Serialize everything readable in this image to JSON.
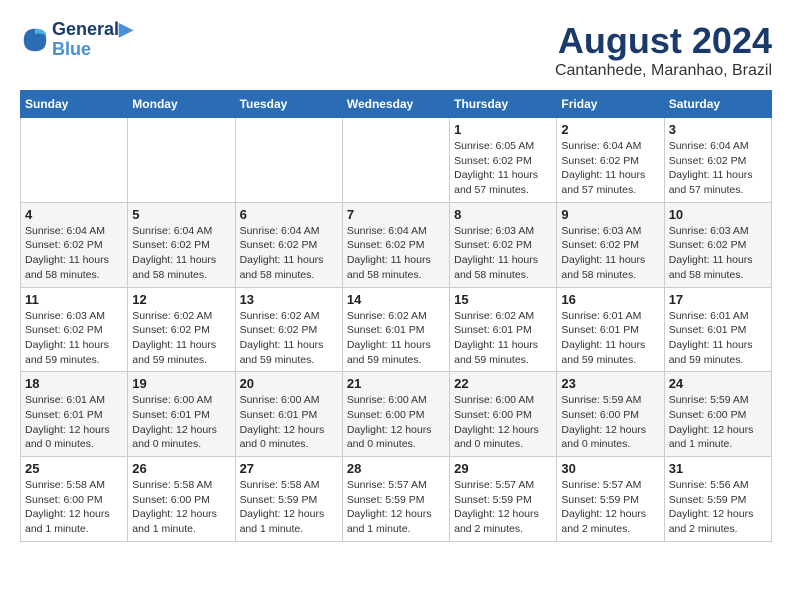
{
  "header": {
    "logo_line1": "General",
    "logo_line2": "Blue",
    "month_year": "August 2024",
    "location": "Cantanhede, Maranhao, Brazil"
  },
  "weekdays": [
    "Sunday",
    "Monday",
    "Tuesday",
    "Wednesday",
    "Thursday",
    "Friday",
    "Saturday"
  ],
  "weeks": [
    [
      {
        "day": "",
        "info": ""
      },
      {
        "day": "",
        "info": ""
      },
      {
        "day": "",
        "info": ""
      },
      {
        "day": "",
        "info": ""
      },
      {
        "day": "1",
        "info": "Sunrise: 6:05 AM\nSunset: 6:02 PM\nDaylight: 11 hours and 57 minutes."
      },
      {
        "day": "2",
        "info": "Sunrise: 6:04 AM\nSunset: 6:02 PM\nDaylight: 11 hours and 57 minutes."
      },
      {
        "day": "3",
        "info": "Sunrise: 6:04 AM\nSunset: 6:02 PM\nDaylight: 11 hours and 57 minutes."
      }
    ],
    [
      {
        "day": "4",
        "info": "Sunrise: 6:04 AM\nSunset: 6:02 PM\nDaylight: 11 hours and 58 minutes."
      },
      {
        "day": "5",
        "info": "Sunrise: 6:04 AM\nSunset: 6:02 PM\nDaylight: 11 hours and 58 minutes."
      },
      {
        "day": "6",
        "info": "Sunrise: 6:04 AM\nSunset: 6:02 PM\nDaylight: 11 hours and 58 minutes."
      },
      {
        "day": "7",
        "info": "Sunrise: 6:04 AM\nSunset: 6:02 PM\nDaylight: 11 hours and 58 minutes."
      },
      {
        "day": "8",
        "info": "Sunrise: 6:03 AM\nSunset: 6:02 PM\nDaylight: 11 hours and 58 minutes."
      },
      {
        "day": "9",
        "info": "Sunrise: 6:03 AM\nSunset: 6:02 PM\nDaylight: 11 hours and 58 minutes."
      },
      {
        "day": "10",
        "info": "Sunrise: 6:03 AM\nSunset: 6:02 PM\nDaylight: 11 hours and 58 minutes."
      }
    ],
    [
      {
        "day": "11",
        "info": "Sunrise: 6:03 AM\nSunset: 6:02 PM\nDaylight: 11 hours and 59 minutes."
      },
      {
        "day": "12",
        "info": "Sunrise: 6:02 AM\nSunset: 6:02 PM\nDaylight: 11 hours and 59 minutes."
      },
      {
        "day": "13",
        "info": "Sunrise: 6:02 AM\nSunset: 6:02 PM\nDaylight: 11 hours and 59 minutes."
      },
      {
        "day": "14",
        "info": "Sunrise: 6:02 AM\nSunset: 6:01 PM\nDaylight: 11 hours and 59 minutes."
      },
      {
        "day": "15",
        "info": "Sunrise: 6:02 AM\nSunset: 6:01 PM\nDaylight: 11 hours and 59 minutes."
      },
      {
        "day": "16",
        "info": "Sunrise: 6:01 AM\nSunset: 6:01 PM\nDaylight: 11 hours and 59 minutes."
      },
      {
        "day": "17",
        "info": "Sunrise: 6:01 AM\nSunset: 6:01 PM\nDaylight: 11 hours and 59 minutes."
      }
    ],
    [
      {
        "day": "18",
        "info": "Sunrise: 6:01 AM\nSunset: 6:01 PM\nDaylight: 12 hours and 0 minutes."
      },
      {
        "day": "19",
        "info": "Sunrise: 6:00 AM\nSunset: 6:01 PM\nDaylight: 12 hours and 0 minutes."
      },
      {
        "day": "20",
        "info": "Sunrise: 6:00 AM\nSunset: 6:01 PM\nDaylight: 12 hours and 0 minutes."
      },
      {
        "day": "21",
        "info": "Sunrise: 6:00 AM\nSunset: 6:00 PM\nDaylight: 12 hours and 0 minutes."
      },
      {
        "day": "22",
        "info": "Sunrise: 6:00 AM\nSunset: 6:00 PM\nDaylight: 12 hours and 0 minutes."
      },
      {
        "day": "23",
        "info": "Sunrise: 5:59 AM\nSunset: 6:00 PM\nDaylight: 12 hours and 0 minutes."
      },
      {
        "day": "24",
        "info": "Sunrise: 5:59 AM\nSunset: 6:00 PM\nDaylight: 12 hours and 1 minute."
      }
    ],
    [
      {
        "day": "25",
        "info": "Sunrise: 5:58 AM\nSunset: 6:00 PM\nDaylight: 12 hours and 1 minute."
      },
      {
        "day": "26",
        "info": "Sunrise: 5:58 AM\nSunset: 6:00 PM\nDaylight: 12 hours and 1 minute."
      },
      {
        "day": "27",
        "info": "Sunrise: 5:58 AM\nSunset: 5:59 PM\nDaylight: 12 hours and 1 minute."
      },
      {
        "day": "28",
        "info": "Sunrise: 5:57 AM\nSunset: 5:59 PM\nDaylight: 12 hours and 1 minute."
      },
      {
        "day": "29",
        "info": "Sunrise: 5:57 AM\nSunset: 5:59 PM\nDaylight: 12 hours and 2 minutes."
      },
      {
        "day": "30",
        "info": "Sunrise: 5:57 AM\nSunset: 5:59 PM\nDaylight: 12 hours and 2 minutes."
      },
      {
        "day": "31",
        "info": "Sunrise: 5:56 AM\nSunset: 5:59 PM\nDaylight: 12 hours and 2 minutes."
      }
    ]
  ]
}
